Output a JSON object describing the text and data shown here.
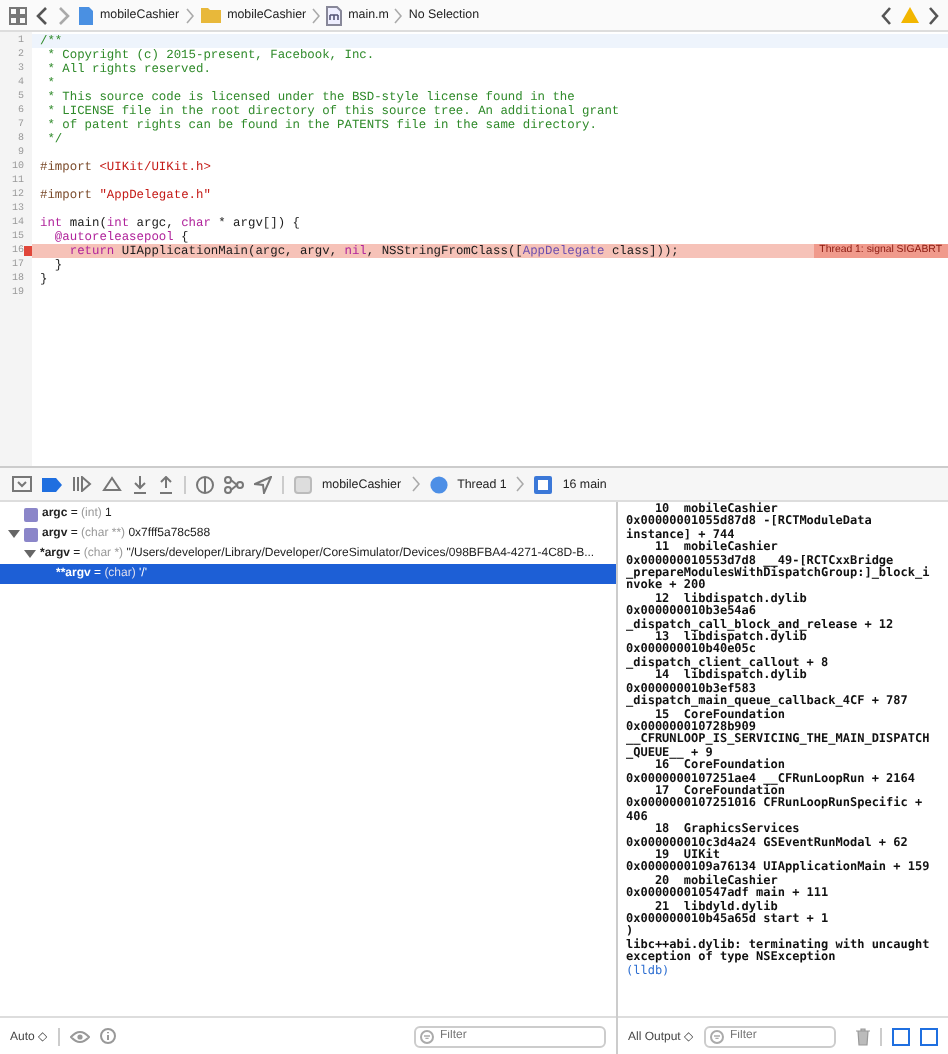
{
  "jump_bar": {
    "crumbs": [
      {
        "kind": "project",
        "label": "mobileCashier"
      },
      {
        "kind": "folder",
        "label": "mobileCashier"
      },
      {
        "kind": "source",
        "label": "main.m"
      },
      {
        "kind": "plain",
        "label": "No Selection"
      }
    ]
  },
  "editor": {
    "lines": [
      {
        "number": "1",
        "tokens": [
          {
            "kind": "comment",
            "text": "/**"
          }
        ]
      },
      {
        "number": "2",
        "tokens": [
          {
            "kind": "comment",
            "text": " * Copyright (c) 2015-present, Facebook, Inc."
          }
        ]
      },
      {
        "number": "3",
        "tokens": [
          {
            "kind": "comment",
            "text": " * All rights reserved."
          }
        ]
      },
      {
        "number": "4",
        "tokens": [
          {
            "kind": "comment",
            "text": " *"
          }
        ]
      },
      {
        "number": "5",
        "tokens": [
          {
            "kind": "comment",
            "text": " * This source code is licensed under the BSD-style license found in the"
          }
        ]
      },
      {
        "number": "6",
        "tokens": [
          {
            "kind": "comment",
            "text": " * LICENSE file in the root directory of this source tree. An additional grant"
          }
        ]
      },
      {
        "number": "7",
        "tokens": [
          {
            "kind": "comment",
            "text": " * of patent rights can be found in the PATENTS file in the same directory."
          }
        ]
      },
      {
        "number": "8",
        "tokens": [
          {
            "kind": "comment",
            "text": " */"
          }
        ]
      },
      {
        "number": "9"
      },
      {
        "number": "10",
        "tokens": [
          {
            "kind": "directive",
            "text": "#import "
          },
          {
            "kind": "string",
            "text": "<UIKit/UIKit.h>"
          }
        ]
      },
      {
        "number": "11"
      },
      {
        "number": "12",
        "tokens": [
          {
            "kind": "directive",
            "text": "#import "
          },
          {
            "kind": "string",
            "text": "\"AppDelegate.h\""
          }
        ]
      },
      {
        "number": "13"
      },
      {
        "number": "14",
        "tokens": [
          {
            "kind": "keyword",
            "text": "int"
          },
          {
            "kind": "plain",
            "text": " main("
          },
          {
            "kind": "keyword",
            "text": "int"
          },
          {
            "kind": "plain",
            "text": " argc, "
          },
          {
            "kind": "keyword",
            "text": "char"
          },
          {
            "kind": "plain",
            "text": " * argv[]) {"
          }
        ]
      },
      {
        "number": "15",
        "tokens": [
          {
            "kind": "keyword",
            "text": "  @autoreleasepool"
          },
          {
            "kind": "plain",
            "text": " {"
          }
        ]
      },
      {
        "number": "16",
        "error": "Thread 1: signal SIGABRT",
        "tokens": [
          {
            "kind": "keyword",
            "text": "    return"
          },
          {
            "kind": "plain",
            "text": " UIApplicationMain(argc, argv, "
          },
          {
            "kind": "keyword",
            "text": "nil"
          },
          {
            "kind": "plain",
            "text": ", NSStringFromClass(["
          },
          {
            "kind": "type",
            "text": "AppDelegate"
          },
          {
            "kind": "plain",
            "text": " class]));"
          }
        ]
      },
      {
        "number": "17",
        "tokens": [
          {
            "kind": "plain",
            "text": "  }"
          }
        ]
      },
      {
        "number": "18",
        "tokens": [
          {
            "kind": "plain",
            "text": "}"
          }
        ]
      },
      {
        "number": "19"
      }
    ]
  },
  "debug_bar": {
    "crumbs": [
      {
        "kind": "app",
        "label": "mobileCashier"
      },
      {
        "kind": "thread",
        "label": "Thread 1"
      },
      {
        "kind": "frame",
        "label": "16 main"
      }
    ]
  },
  "variables": [
    {
      "name": "argc",
      "equals": "=",
      "type": "(int)",
      "value": "1",
      "badge": true,
      "selected": false
    },
    {
      "name": "argv",
      "equals": "=",
      "type": "(char **)",
      "value": "0x7fff5a78c588",
      "badge": true,
      "selected": false,
      "expanded": true,
      "children": [
        {
          "name": "*argv",
          "equals": "=",
          "type": "(char *)",
          "value": "\"/Users/developer/Library/Developer/CoreSimulator/Devices/098BFBA4-4271-4C8D-B...",
          "badge": false,
          "selected": false,
          "expanded": true,
          "children": [
            {
              "name": "**argv",
              "equals": "=",
              "type": "(char)",
              "value": "'/'",
              "badge": false,
              "selected": true
            }
          ]
        }
      ]
    }
  ],
  "variables_footer": {
    "scope": "Auto ◇",
    "filter_placeholder": "Filter"
  },
  "console": {
    "lines": [
      {
        "kind": "output",
        "text": "    10  mobileCashier"
      },
      {
        "kind": "output",
        "text": "0x00000001055d87d8 -[RCTModuleData"
      },
      {
        "kind": "output",
        "text": "instance] + 744"
      },
      {
        "kind": "output",
        "text": "    11  mobileCashier"
      },
      {
        "kind": "output",
        "text": "0x000000010553d7d8 __49-[RCTCxxBridge"
      },
      {
        "kind": "output",
        "text": "_prepareModulesWithDispatchGroup:]_block_i"
      },
      {
        "kind": "output",
        "text": "nvoke + 200"
      },
      {
        "kind": "output",
        "text": "    12  libdispatch.dylib"
      },
      {
        "kind": "output",
        "text": "0x000000010b3e54a6"
      },
      {
        "kind": "output",
        "text": "_dispatch_call_block_and_release + 12"
      },
      {
        "kind": "output",
        "text": "    13  libdispatch.dylib"
      },
      {
        "kind": "output",
        "text": "0x000000010b40e05c"
      },
      {
        "kind": "output",
        "text": "_dispatch_client_callout + 8"
      },
      {
        "kind": "output",
        "text": "    14  libdispatch.dylib"
      },
      {
        "kind": "output",
        "text": "0x000000010b3ef583"
      },
      {
        "kind": "output",
        "text": "_dispatch_main_queue_callback_4CF + 787"
      },
      {
        "kind": "output",
        "text": "    15  CoreFoundation"
      },
      {
        "kind": "output",
        "text": "0x000000010728b909"
      },
      {
        "kind": "output",
        "text": "__CFRUNLOOP_IS_SERVICING_THE_MAIN_DISPATCH"
      },
      {
        "kind": "output",
        "text": "_QUEUE__ + 9"
      },
      {
        "kind": "output",
        "text": "    16  CoreFoundation"
      },
      {
        "kind": "output",
        "text": "0x0000000107251ae4 __CFRunLoopRun + 2164"
      },
      {
        "kind": "output",
        "text": "    17  CoreFoundation"
      },
      {
        "kind": "output",
        "text": "0x0000000107251016 CFRunLoopRunSpecific +"
      },
      {
        "kind": "output",
        "text": "406"
      },
      {
        "kind": "output",
        "text": "    18  GraphicsServices"
      },
      {
        "kind": "output",
        "text": "0x000000010c3d4a24 GSEventRunModal + 62"
      },
      {
        "kind": "output",
        "text": "    19  UIKit"
      },
      {
        "kind": "output",
        "text": "0x0000000109a76134 UIApplicationMain + 159"
      },
      {
        "kind": "output",
        "text": "    20  mobileCashier"
      },
      {
        "kind": "output",
        "text": "0x000000010547adf main + 111"
      },
      {
        "kind": "output",
        "text": "    21  libdyld.dylib"
      },
      {
        "kind": "output",
        "text": "0x000000010b45a65d start + 1"
      },
      {
        "kind": "output",
        "text": ")"
      },
      {
        "kind": "output",
        "text": "libc++abi.dylib: terminating with uncaught"
      },
      {
        "kind": "output",
        "text": "exception of type NSException"
      },
      {
        "kind": "prompt",
        "text": "(lldb)"
      }
    ]
  },
  "console_footer": {
    "output": "All Output ◇",
    "filter_placeholder": "Filter"
  }
}
